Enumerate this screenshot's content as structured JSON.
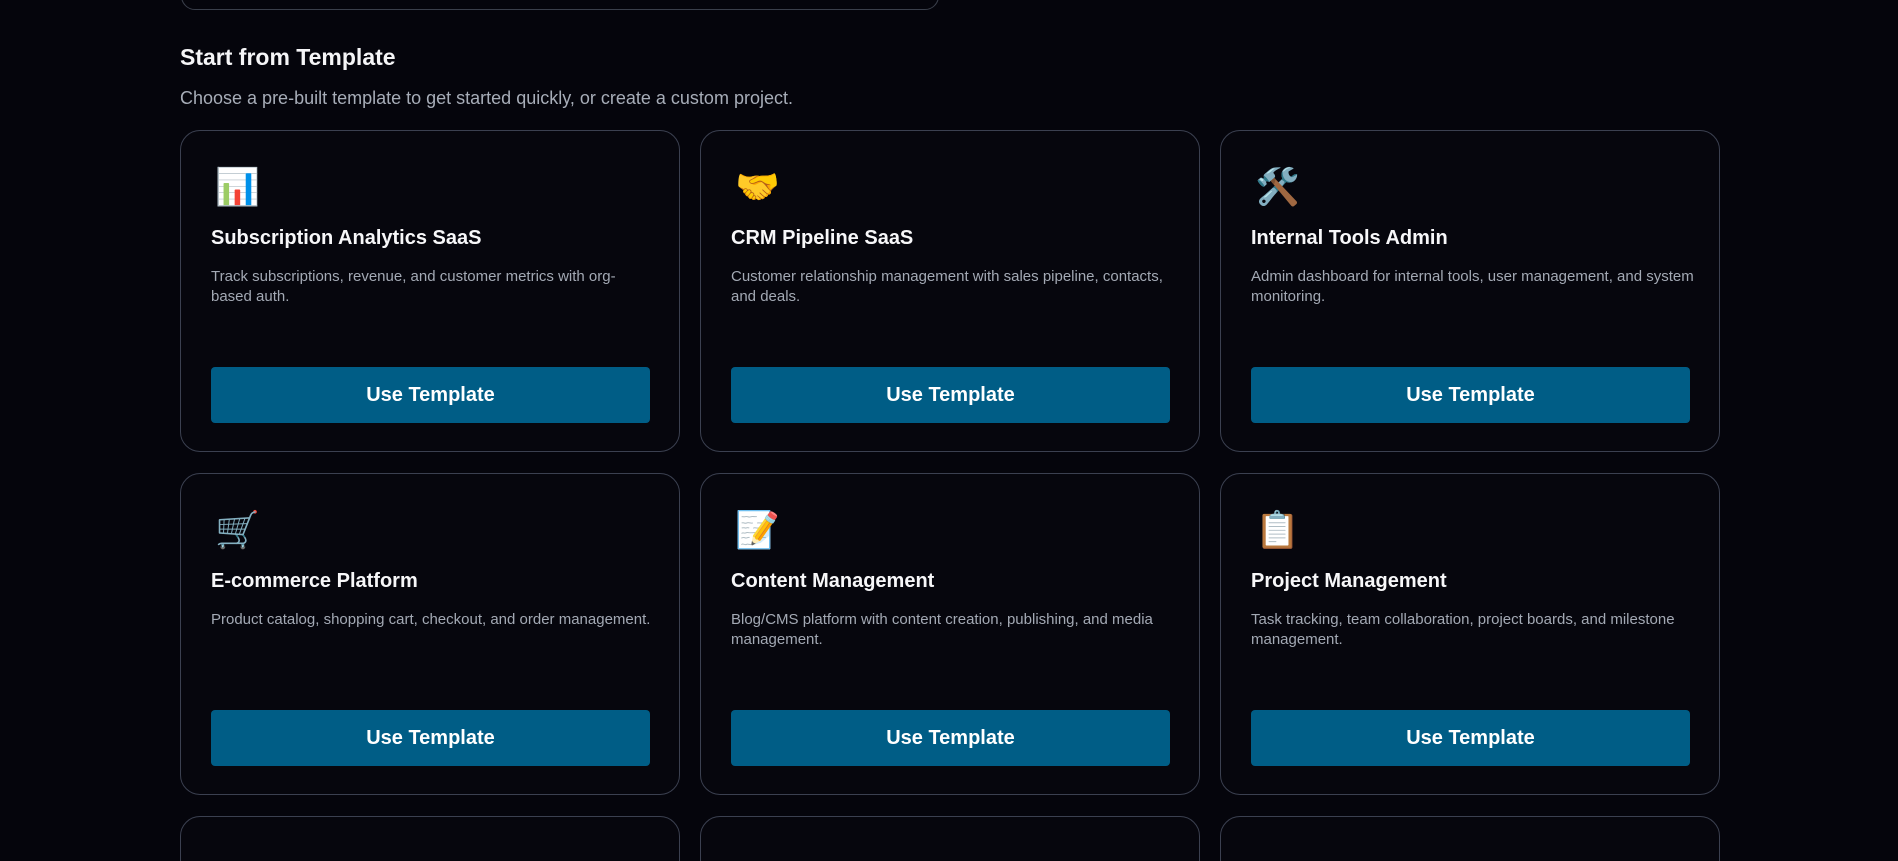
{
  "section": {
    "title": "Start from Template",
    "subtitle": "Choose a pre-built template to get started quickly, or create a custom project."
  },
  "templates": [
    {
      "icon": "bar-chart-icon",
      "glyph": "📊",
      "title": "Subscription Analytics SaaS",
      "description": "Track subscriptions, revenue, and customer metrics with org-based auth.",
      "button": "Use Template"
    },
    {
      "icon": "handshake-icon",
      "glyph": "🤝",
      "title": "CRM Pipeline SaaS",
      "description": "Customer relationship management with sales pipeline, contacts, and deals.",
      "button": "Use Template"
    },
    {
      "icon": "tools-icon",
      "glyph": "🛠️",
      "title": "Internal Tools Admin",
      "description": "Admin dashboard for internal tools, user management, and system monitoring.",
      "button": "Use Template"
    },
    {
      "icon": "shopping-cart-icon",
      "glyph": "🛒",
      "title": "E-commerce Platform",
      "description": "Product catalog, shopping cart, checkout, and order management.",
      "button": "Use Template"
    },
    {
      "icon": "memo-icon",
      "glyph": "📝",
      "title": "Content Management",
      "description": "Blog/CMS platform with content creation, publishing, and media management.",
      "button": "Use Template"
    },
    {
      "icon": "clipboard-icon",
      "glyph": "📋",
      "title": "Project Management",
      "description": "Task tracking, team collaboration, project boards, and milestone management.",
      "button": "Use Template"
    }
  ]
}
